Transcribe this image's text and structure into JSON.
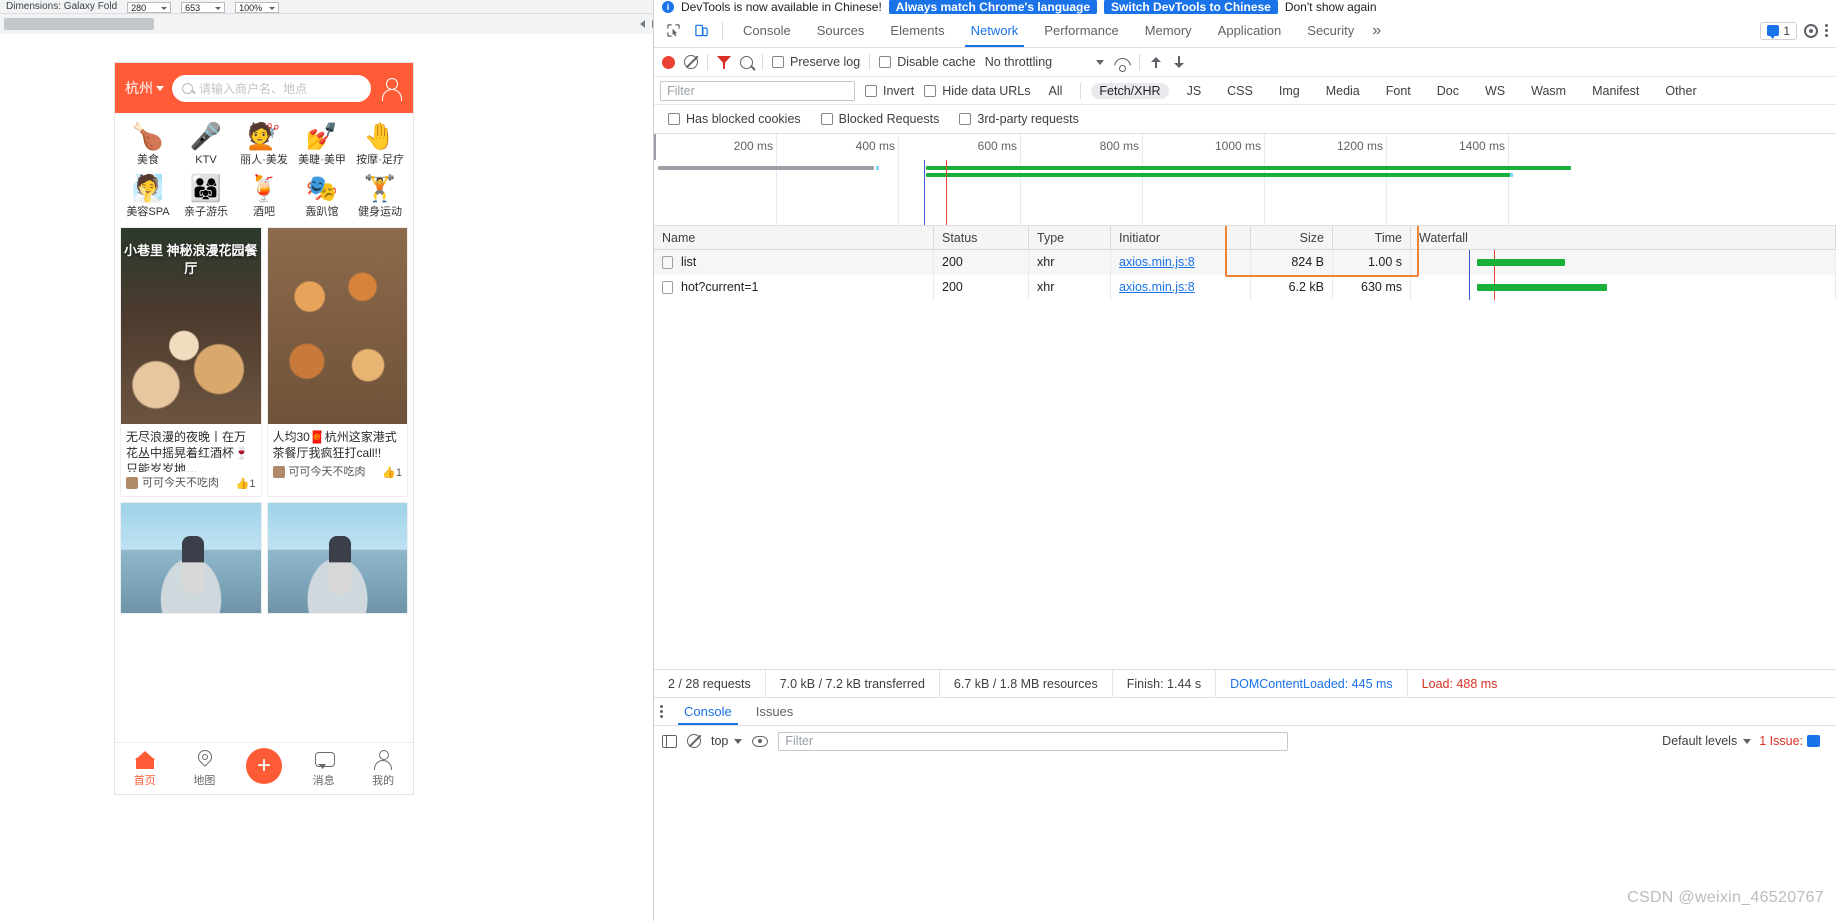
{
  "browser_strip": {
    "label_left": "Dimensions: Galaxy Fold",
    "width_value": "280",
    "height_value": "653",
    "zoom_value": "100%"
  },
  "phone": {
    "city": "杭州",
    "search_placeholder": "请输入商户名、地点",
    "user_icon": "user-icon",
    "categories": [
      {
        "icon": "🍗",
        "label": "美食"
      },
      {
        "icon": "🎤",
        "label": "KTV"
      },
      {
        "icon": "💇",
        "label": "丽人·美发"
      },
      {
        "icon": "💅",
        "label": "美睫·美甲"
      },
      {
        "icon": "🤚",
        "label": "按摩·足疗"
      },
      {
        "icon": "🧖",
        "label": "美容SPA"
      },
      {
        "icon": "👨‍👩‍👧",
        "label": "亲子游乐"
      },
      {
        "icon": "🍹",
        "label": "酒吧"
      },
      {
        "icon": "🎭",
        "label": "轰趴馆"
      },
      {
        "icon": "🏋️",
        "label": "健身运动"
      }
    ],
    "feed": [
      {
        "overlay_title": "小巷里\n神秘浪漫花园餐厅",
        "text": "无尽浪漫的夜晚丨在万花丛中摇晃着红酒杯🍷只能岁岁地…",
        "user": "可可今天不吃肉",
        "likes": "1",
        "thumb": "thumb-a"
      },
      {
        "overlay_title": "",
        "text": "人均30🧧杭州这家港式茶餐厅我疯狂打call!!",
        "user": "可可今天不吃肉",
        "likes": "1",
        "thumb": "thumb-b"
      },
      {
        "overlay_title": "",
        "text": "",
        "user": "",
        "likes": "",
        "thumb": "thumb-c"
      },
      {
        "overlay_title": "",
        "text": "",
        "user": "",
        "likes": "",
        "thumb": "thumb-d"
      }
    ],
    "tabbar": [
      {
        "icon": "home-icon",
        "label": "首页",
        "active": true
      },
      {
        "icon": "map-pin-icon",
        "label": "地图",
        "active": false
      },
      {
        "icon": "plus-icon",
        "label": "",
        "active": false
      },
      {
        "icon": "message-icon",
        "label": "消息",
        "active": false
      },
      {
        "icon": "person-icon",
        "label": "我的",
        "active": false
      }
    ]
  },
  "devtools": {
    "banner": {
      "info": "i",
      "message": "DevTools is now available in Chinese!",
      "primary_button": "Always match Chrome's language",
      "secondary_button": "Switch DevTools to Chinese",
      "dismiss": "Don't show again"
    },
    "panel_tabs": [
      {
        "label": "Console",
        "selected": false
      },
      {
        "label": "Sources",
        "selected": false
      },
      {
        "label": "Elements",
        "selected": false
      },
      {
        "label": "Network",
        "selected": true
      },
      {
        "label": "Performance",
        "selected": false
      },
      {
        "label": "Memory",
        "selected": false
      },
      {
        "label": "Application",
        "selected": false
      },
      {
        "label": "Security",
        "selected": false
      }
    ],
    "more_tabs": "»",
    "issues_count": "1",
    "toolbar": {
      "record_icon": "record-icon",
      "clear_icon": "clear-icon",
      "filter_icon": "filter-icon",
      "search_icon": "search-icon",
      "preserve_log": "Preserve log",
      "disable_cache": "Disable cache",
      "throttling": "No throttling",
      "wifi_icon": "network-conditions-icon",
      "import_icon": "import-har-icon",
      "export_icon": "export-har-icon"
    },
    "filter_row": {
      "filter_placeholder": "Filter",
      "invert": "Invert",
      "hide_data_urls": "Hide data URLs",
      "types": [
        {
          "label": "All",
          "on": false
        },
        {
          "label": "Fetch/XHR",
          "on": true
        },
        {
          "label": "JS",
          "on": false
        },
        {
          "label": "CSS",
          "on": false
        },
        {
          "label": "Img",
          "on": false
        },
        {
          "label": "Media",
          "on": false
        },
        {
          "label": "Font",
          "on": false
        },
        {
          "label": "Doc",
          "on": false
        },
        {
          "label": "WS",
          "on": false
        },
        {
          "label": "Wasm",
          "on": false
        },
        {
          "label": "Manifest",
          "on": false
        },
        {
          "label": "Other",
          "on": false
        }
      ]
    },
    "filter_row2": {
      "has_blocked_cookies": "Has blocked cookies",
      "blocked_requests": "Blocked Requests",
      "third_party": "3rd-party requests"
    },
    "overview": {
      "ticks": [
        "200 ms",
        "400 ms",
        "600 ms",
        "800 ms",
        "1000 ms",
        "1200 ms",
        "1400 ms"
      ]
    },
    "table": {
      "columns": [
        "Name",
        "Status",
        "Type",
        "Initiator",
        "Size",
        "Time",
        "Waterfall"
      ],
      "rows": [
        {
          "name": "list",
          "status": "200",
          "type": "xhr",
          "initiator": "axios.min.js:8",
          "size": "824 B",
          "time": "1.00 s"
        },
        {
          "name": "hot?current=1",
          "status": "200",
          "type": "xhr",
          "initiator": "axios.min.js:8",
          "size": "6.2 kB",
          "time": "630 ms"
        }
      ],
      "highlight_color": "#ef8233"
    },
    "summary": {
      "requests": "2 / 28 requests",
      "transferred": "7.0 kB / 7.2 kB transferred",
      "resources": "6.7 kB / 1.8 MB resources",
      "finish": "Finish: 1.44 s",
      "dom_content_loaded": "DOMContentLoaded: 445 ms",
      "load": "Load: 488 ms"
    },
    "drawer_tabs": [
      {
        "label": "Console",
        "selected": true
      },
      {
        "label": "Issues",
        "selected": false
      }
    ],
    "console_bar": {
      "sidebar_icon": "sidebar-icon",
      "clear_icon": "clear-console-icon",
      "context": "top",
      "eye_icon": "live-expression-icon",
      "filter_placeholder": "Filter",
      "levels": "Default levels",
      "issue_text": "1 Issue:"
    },
    "watermark": "CSDN @weixin_46520767"
  },
  "colors": {
    "accent_blue": "#1a73e8",
    "record_red": "#ea4335",
    "waterfall_green": "#19b039",
    "highlight_orange": "#ef8233",
    "brand_orange": "#ff5b36"
  }
}
